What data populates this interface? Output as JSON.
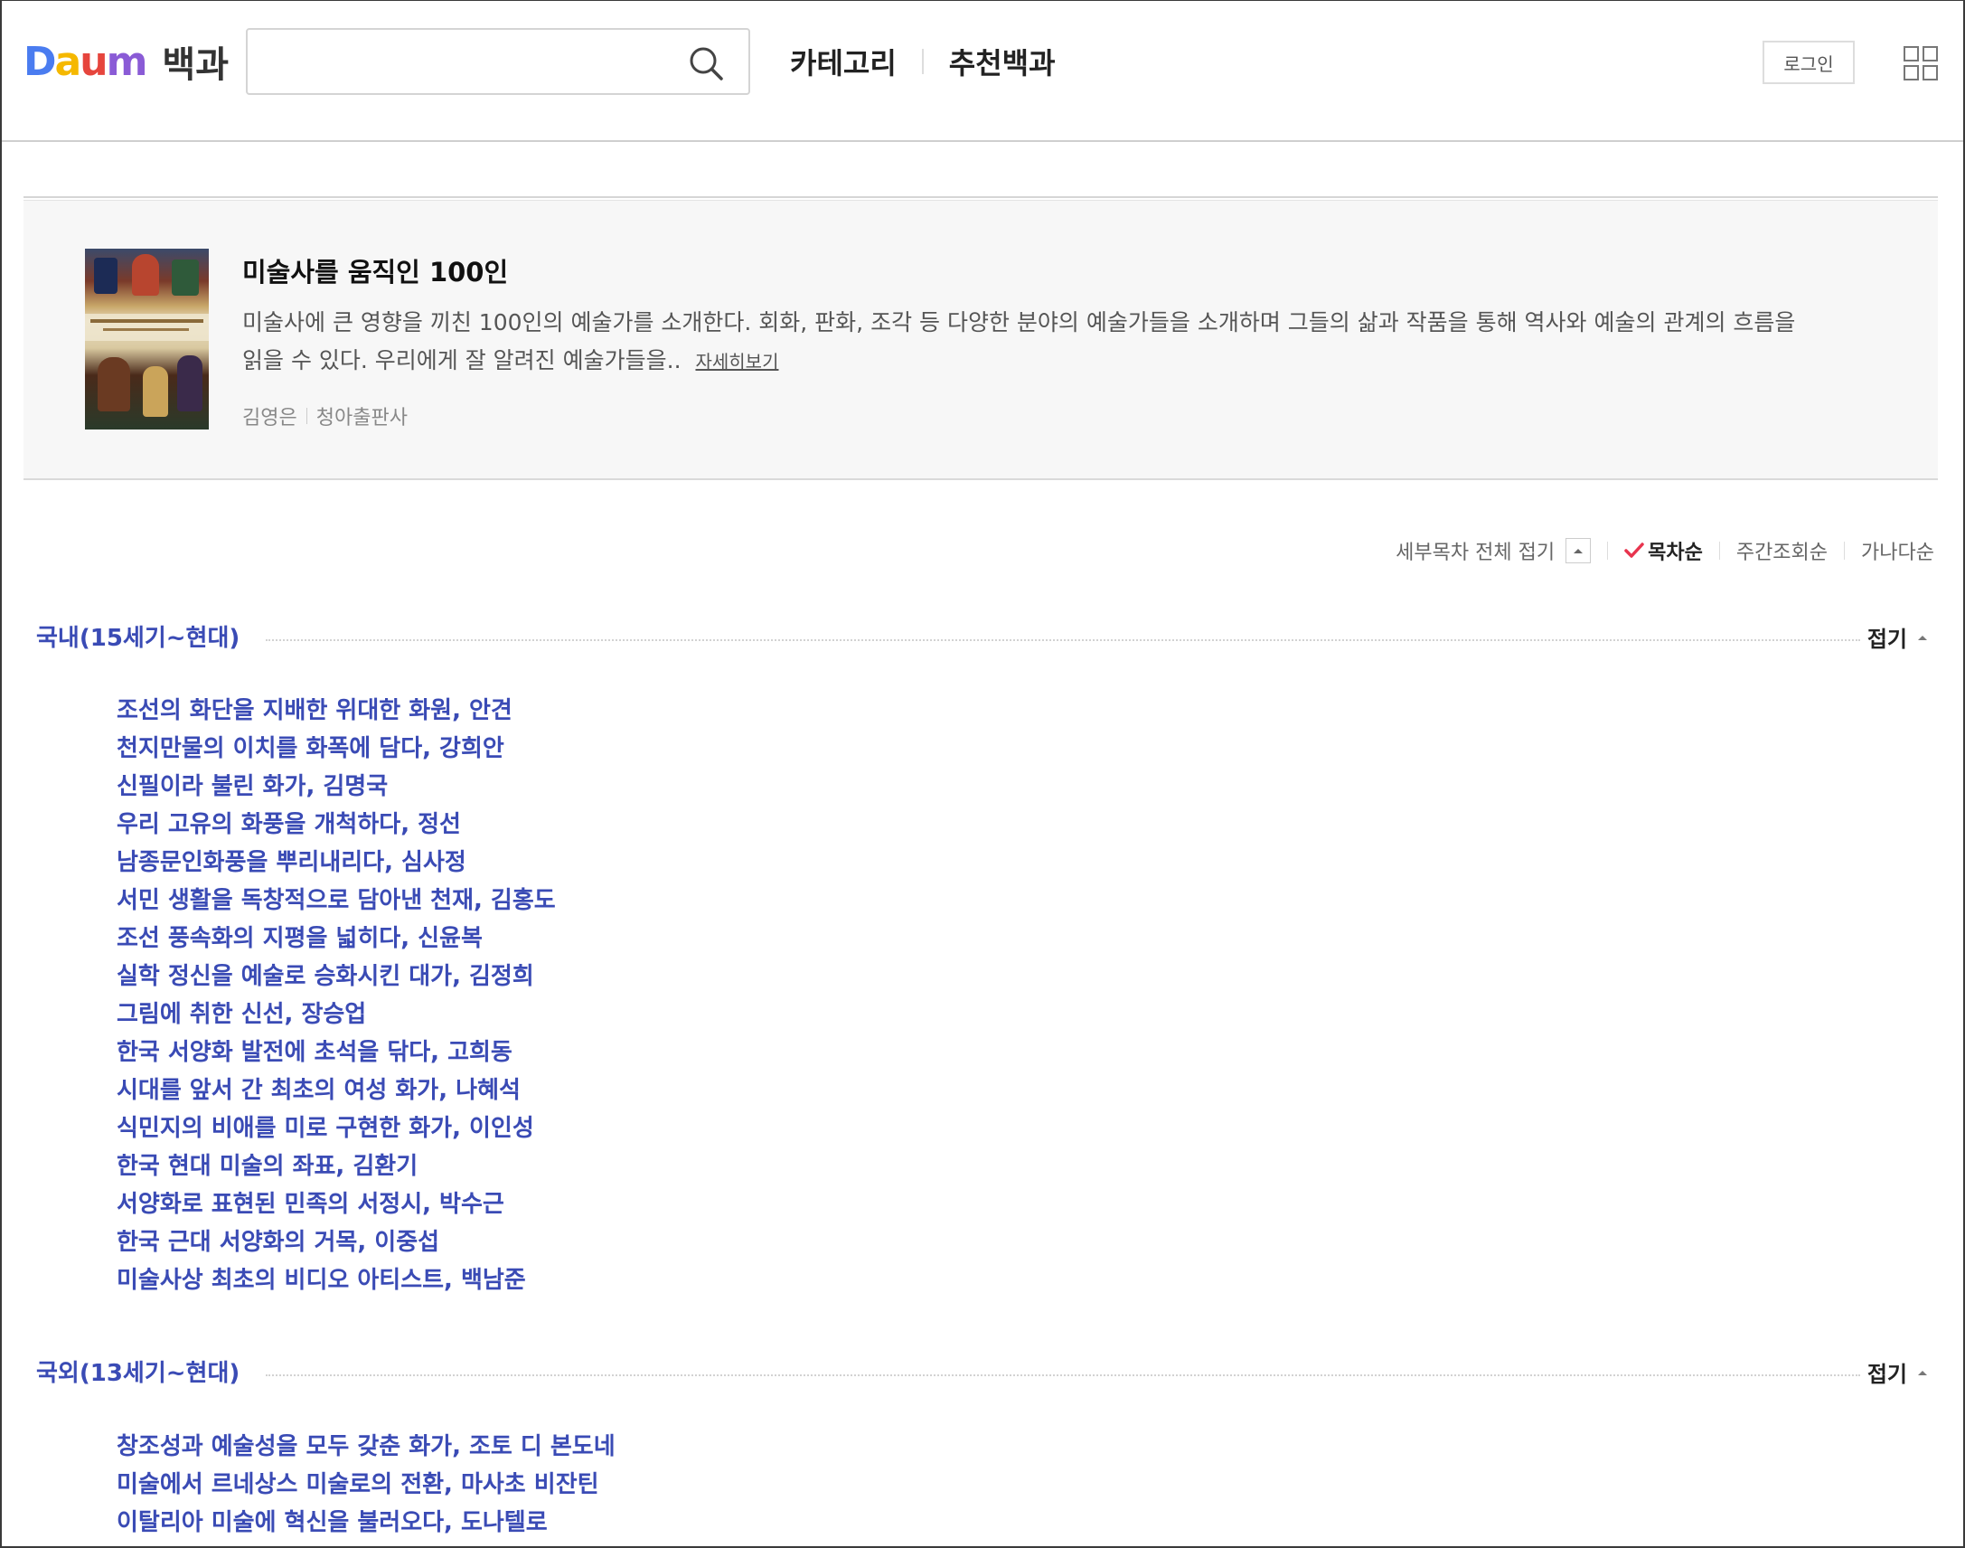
{
  "header": {
    "logo_brand": "Daum",
    "logo_service": "백과",
    "search": {
      "value": "",
      "placeholder": ""
    },
    "nav": [
      "카테고리",
      "추천백과"
    ],
    "login_label": "로그인"
  },
  "book": {
    "title": "미술사를 움직인 100인",
    "description": "미술사에 큰 영향을 끼친 100인의 예술가를 소개한다. 회화, 판화, 조각 등 다양한 분야의 예술가들을 소개하며 그들의 삶과 작품을 통해 역사와 예술의 관계의 흐름을 읽을 수 있다. 우리에게 잘 알려진 예술가들을..",
    "more_label": "자세히보기",
    "author": "김영은",
    "publisher": "청아출판사"
  },
  "sortbar": {
    "toc_toggle_label": "세부목차 전체 접기",
    "options": [
      "목차순",
      "주간조회순",
      "가나다순"
    ],
    "active": "목차순"
  },
  "sections": [
    {
      "title": "국내(15세기~현대)",
      "fold_label": "접기",
      "items": [
        "조선의 화단을 지배한 위대한 화원, 안견",
        "천지만물의 이치를 화폭에 담다, 강희안",
        "신필이라 불린 화가, 김명국",
        "우리 고유의 화풍을 개척하다, 정선",
        "남종문인화풍을 뿌리내리다, 심사정",
        "서민 생활을 독창적으로 담아낸 천재, 김홍도",
        "조선 풍속화의 지평을 넓히다, 신윤복",
        "실학 정신을 예술로 승화시킨 대가, 김정희",
        "그림에 취한 신선, 장승업",
        "한국 서양화 발전에 초석을 닦다, 고희동",
        "시대를 앞서 간 최초의 여성 화가, 나혜석",
        "식민지의 비애를 미로 구현한 화가, 이인성",
        "한국 현대 미술의 좌표, 김환기",
        "서양화로 표현된 민족의 서정시, 박수근",
        "한국 근대 서양화의 거목, 이중섭",
        "미술사상 최초의 비디오 아티스트, 백남준"
      ]
    },
    {
      "title": "국외(13세기~현대)",
      "fold_label": "접기",
      "items": [
        "창조성과 예술성을 모두 갖춘 화가, 조토 디 본도네",
        "미술에서 르네상스 미술로의 전환, 마사초 비잔틴",
        "이탈리아 미술에 혁신을 불러오다, 도나텔로"
      ]
    }
  ],
  "colors": {
    "link_blue": "#3a4bb5",
    "panel_bg": "#f7f7f7",
    "check_red": "#e8344e"
  }
}
